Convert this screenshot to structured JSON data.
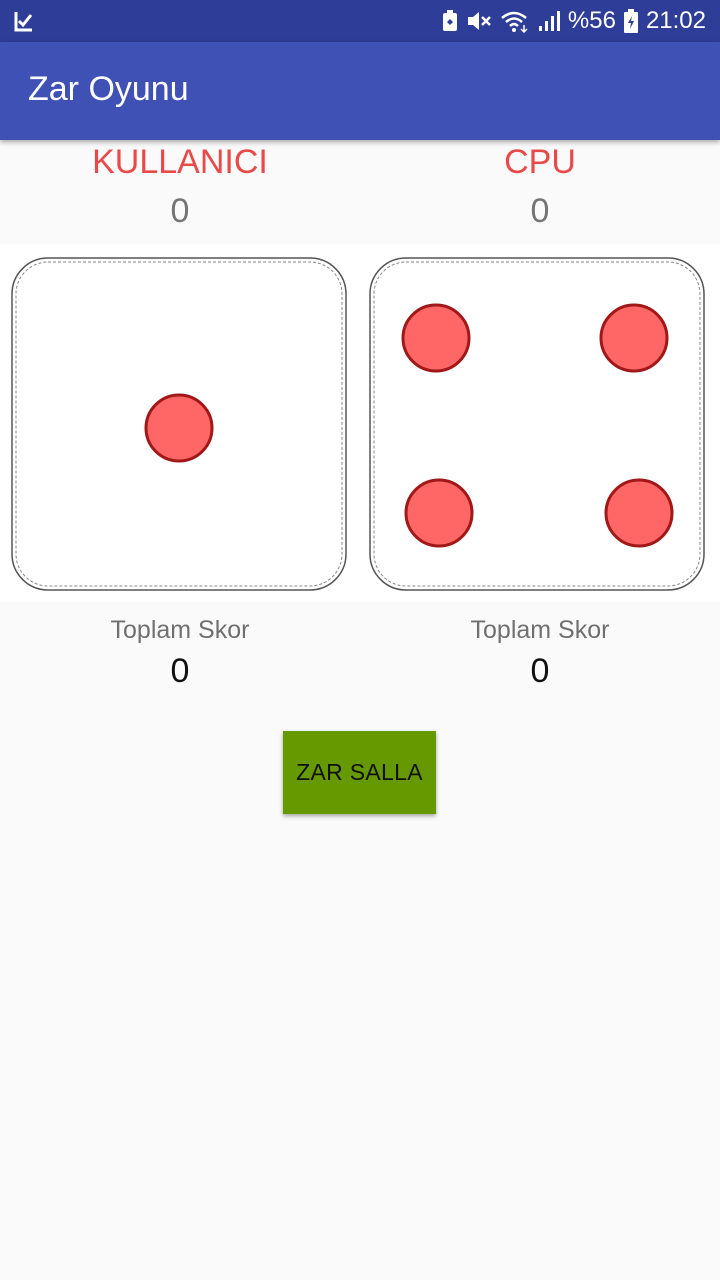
{
  "status_bar": {
    "battery_text": "%56",
    "time": "21:02",
    "icons": [
      "checkmark-notification-icon",
      "battery-saver-icon",
      "mute-icon",
      "wifi-icon",
      "signal-icon",
      "battery-icon"
    ]
  },
  "app_bar": {
    "title": "Zar Oyunu",
    "background": "#3f51b5"
  },
  "players": {
    "user": {
      "name": "KULLANICI",
      "round_score": "0",
      "total_label": "Toplam Skor",
      "total_score": "0",
      "die_value": 1
    },
    "cpu": {
      "name": "CPU",
      "round_score": "0",
      "total_label": "Toplam Skor",
      "total_score": "0",
      "die_value": 4
    }
  },
  "roll_button": {
    "label": "ZAR SALLA",
    "color": "#669900"
  },
  "colors": {
    "player_name": "#e84a4a",
    "pip_fill": "#ff6666",
    "pip_stroke": "#a01818"
  }
}
